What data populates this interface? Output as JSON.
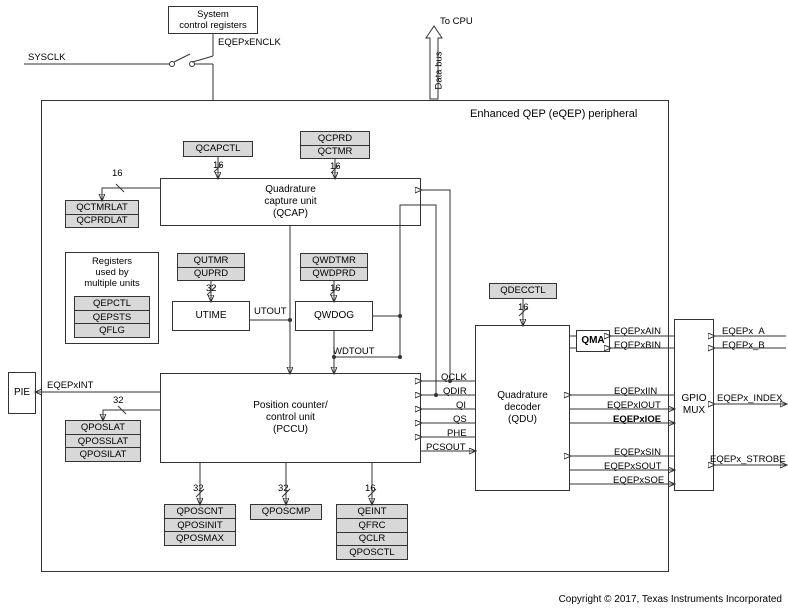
{
  "title": "Enhanced QEP (eQEP) peripheral",
  "top": {
    "sysctrl": "System\ncontrol registers",
    "enclk": "EQEPxENCLK",
    "sysclk": "SYSCLK",
    "tocpu": "To CPU",
    "databus": "Data bus"
  },
  "pie": {
    "label": "PIE",
    "int": "EQEPxINT"
  },
  "qcap": {
    "block": "Quadrature\ncapture unit\n(QCAP)",
    "qcapctl": "QCAPCTL",
    "qcprd": "QCPRD",
    "qctmr": "QCTMR",
    "qctmrlat": "QCTMRLAT",
    "qcprdlat": "QCPRDLAT",
    "w_l": "16",
    "w_c": "16",
    "w_r": "16"
  },
  "multi": {
    "title": "Registers\nused by\nmultiple units",
    "qepctl": "QEPCTL",
    "qepsts": "QEPSTS",
    "qflg": "QFLG"
  },
  "utime": {
    "qutmr": "QUTMR",
    "quprd": "QUPRD",
    "block": "UTIME",
    "w": "32",
    "out": "UTOUT"
  },
  "qwdog": {
    "qwdtmr": "QWDTMR",
    "qwdprd": "QWDPRD",
    "block": "QWDOG",
    "w": "16",
    "out": "WDTOUT"
  },
  "pccu": {
    "block": "Position counter/\ncontrol unit\n(PCCU)",
    "wint": "32"
  },
  "pos_left": {
    "qposlat": "QPOSLAT",
    "qposslat": "QPOSSLAT",
    "qposilat": "QPOSILAT"
  },
  "pos_col1": {
    "qposcnt": "QPOSCNT",
    "qposinit": "QPOSINIT",
    "qposmax": "QPOSMAX",
    "w": "32"
  },
  "pos_col2": {
    "qposcmp": "QPOSCMP",
    "w": "32"
  },
  "pos_col3": {
    "qeint": "QEINT",
    "qfrc": "QFRC",
    "qclr": "QCLR",
    "qposctl": "QPOSCTL",
    "w": "16"
  },
  "qdu": {
    "qdecctl": "QDECCTL",
    "w": "16",
    "block": "Quadrature\ndecoder\n(QDU)",
    "qma": "QMA"
  },
  "sig": {
    "qclk": "QCLK",
    "qdir": "QDIR",
    "qi": "QI",
    "qs": "QS",
    "phe": "PHE",
    "pcsout": "PCSOUT"
  },
  "ext": {
    "ain": "EQEPxAIN",
    "bin": "EQEPxBIN",
    "iin": "EQEPxIIN",
    "iout": "EQEPxIOUT",
    "ioe": "EQEPxIOE",
    "sin": "EQEPxSIN",
    "sout": "EQEPxSOUT",
    "soe": "EQEPxSOE"
  },
  "gpio": {
    "label": "GPIO\nMUX",
    "a": "EQEPx_A",
    "b": "EQEPx_B",
    "idx": "EQEPx_INDEX",
    "strobe": "EQEPx_STROBE"
  },
  "copyright": "Copyright © 2017, Texas Instruments Incorporated"
}
